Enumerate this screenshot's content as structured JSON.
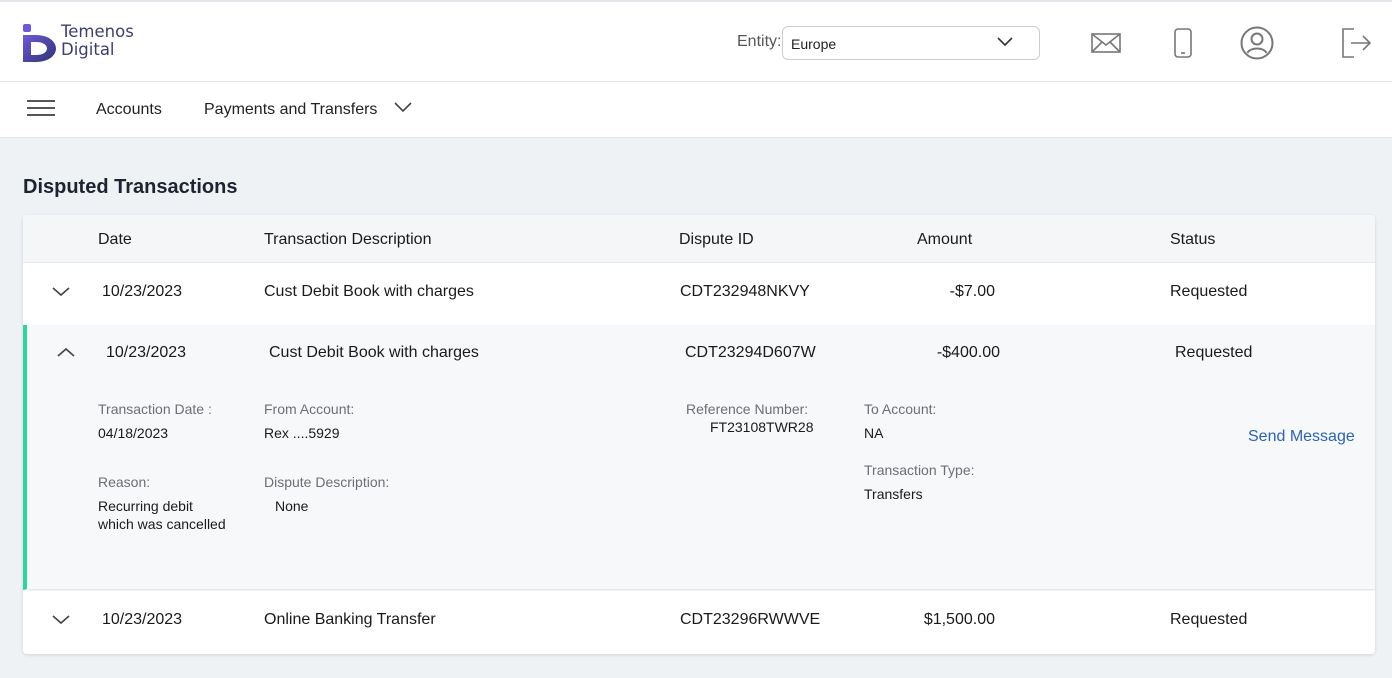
{
  "header": {
    "logo_line1": "Temenos",
    "logo_line2": "Digital",
    "entity_label": "Entity:",
    "entity_value": "Europe",
    "icons": [
      "mail-icon",
      "mobile-icon",
      "user-profile-icon",
      "logout-icon"
    ]
  },
  "nav": {
    "items": [
      {
        "label": "Accounts"
      },
      {
        "label": "Payments and Transfers"
      }
    ]
  },
  "page": {
    "title": "Disputed Transactions"
  },
  "table": {
    "columns": [
      "Date",
      "Transaction Description",
      "Dispute ID",
      "Amount",
      "Status"
    ],
    "rows": [
      {
        "date": "10/23/2023",
        "description": "Cust Debit Book with charges",
        "dispute_id": "CDT232948NKVY",
        "amount": "-$7.00",
        "status": "Requested",
        "expanded": false
      },
      {
        "date": "10/23/2023",
        "description": "Cust Debit Book with charges",
        "dispute_id": "CDT23294D607W",
        "amount": "-$400.00",
        "status": "Requested",
        "expanded": true
      },
      {
        "date": "10/23/2023",
        "description": "Online Banking Transfer",
        "dispute_id": "CDT23296RWWVE",
        "amount": "$1,500.00",
        "status": "Requested",
        "expanded": false
      }
    ]
  },
  "details": {
    "transaction_date_label": "Transaction Date :",
    "transaction_date": "04/18/2023",
    "from_account_label": "From Account:",
    "from_account": "Rex ....5929",
    "reference_number_label": "Reference Number:",
    "reference_number": "FT23108TWR28",
    "to_account_label": "To Account:",
    "to_account": "NA",
    "reason_label": "Reason:",
    "reason_line1": "Recurring debit",
    "reason_line2": "which was cancelled",
    "dispute_description_label": "Dispute Description:",
    "dispute_description": "None",
    "transaction_type_label": "Transaction Type:",
    "transaction_type": "Transfers",
    "send_message": "Send Message"
  },
  "colors": {
    "accent_green": "#2fd39b",
    "link_blue": "#2a63b3",
    "logo_navy": "#3a3f6e"
  }
}
